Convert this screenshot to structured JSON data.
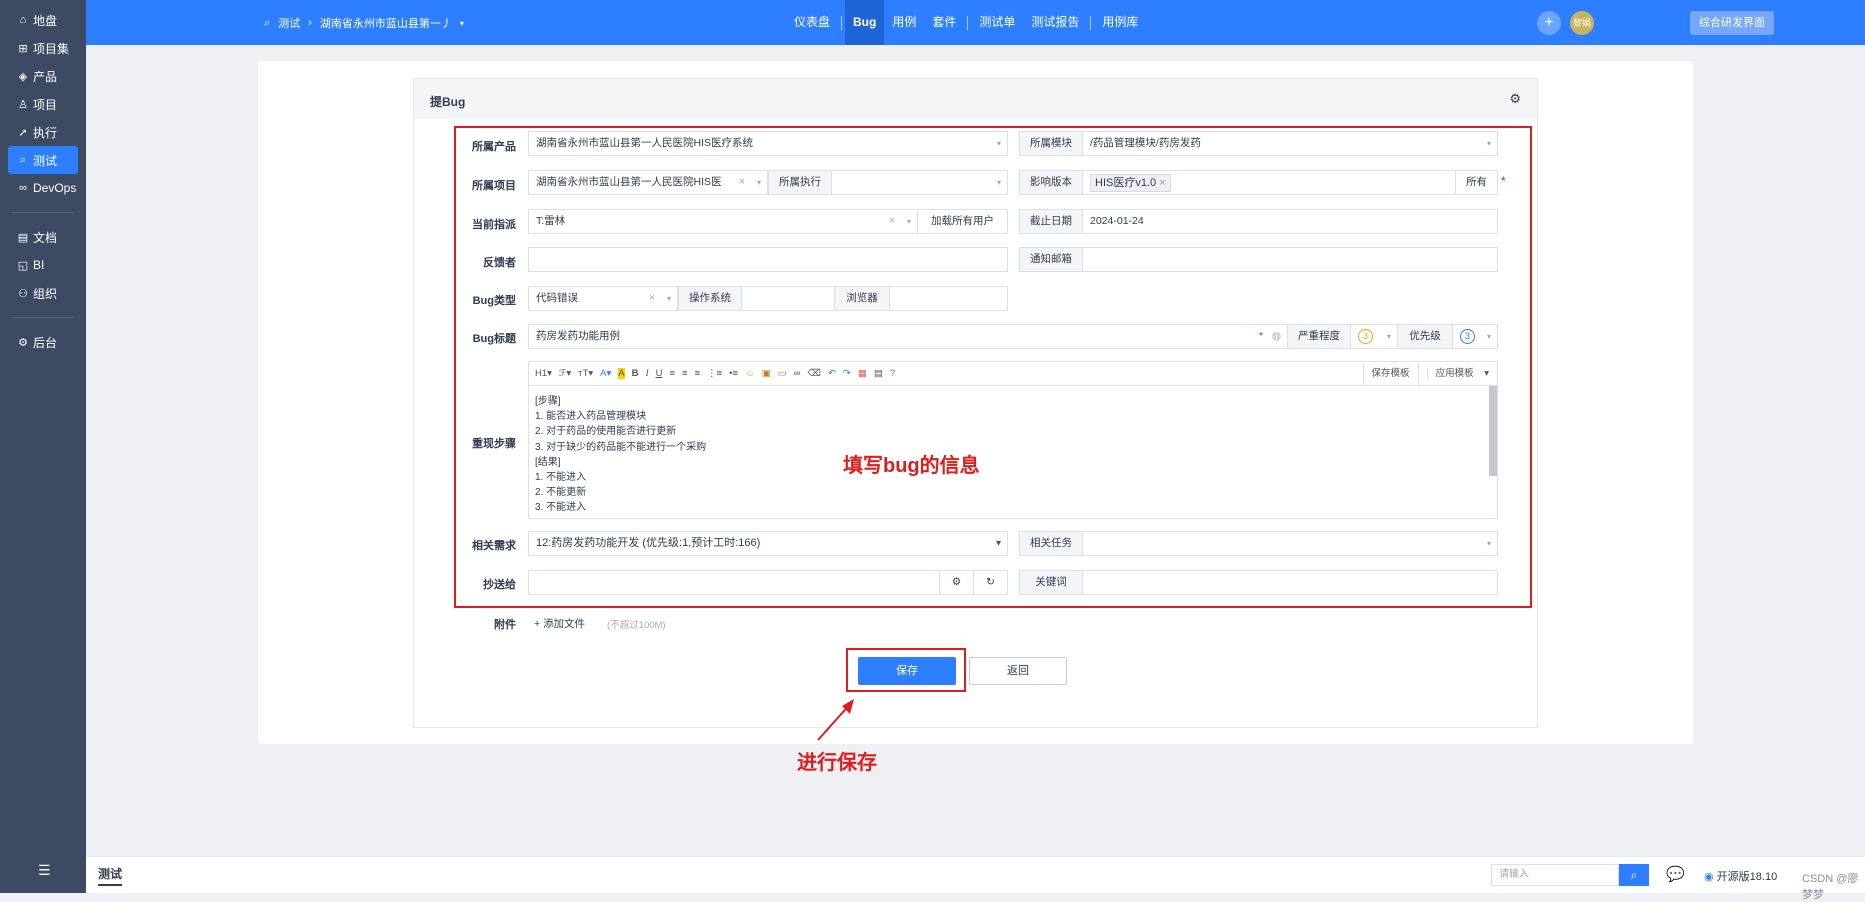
{
  "sidebar": {
    "items": [
      {
        "icon": "⌂",
        "label": "地盘"
      },
      {
        "icon": "⊞",
        "label": "项目集"
      },
      {
        "icon": "◈",
        "label": "产品"
      },
      {
        "icon": "♙",
        "label": "项目"
      },
      {
        "icon": "➚",
        "label": "执行"
      },
      {
        "icon": "⌕",
        "label": "测试"
      },
      {
        "icon": "∞",
        "label": "DevOps"
      },
      {
        "icon": "▤",
        "label": "文档"
      },
      {
        "icon": "◱",
        "label": "BI"
      },
      {
        "icon": "⚇",
        "label": "组织"
      },
      {
        "icon": "⚙",
        "label": "后台"
      }
    ]
  },
  "header": {
    "crumb_module": "测试",
    "crumb_product": "湖南省永州市蓝山县第一丿",
    "nav": [
      "仪表盘",
      "Bug",
      "用例",
      "套件",
      "测试单",
      "测试报告",
      "用例库"
    ],
    "avatar_text": "黎娟",
    "switch_label": "综合研发界面"
  },
  "form": {
    "title": "提Bug",
    "product_label": "所属产品",
    "product_value": "湖南省永州市蓝山县第一人民医院HIS医疗系统",
    "module_label": "所属模块",
    "module_value": "/药品管理模块/药房发药",
    "project_label": "所属项目",
    "project_value": "湖南省永州市蓝山县第一人民医院HIS医",
    "execution_label": "所属执行",
    "execution_value": "",
    "build_label": "影响版本",
    "build_tag": "HIS医疗v1.0",
    "build_all": "所有",
    "assign_label": "当前指派",
    "assign_value": "T:雷林",
    "load_users": "加载所有用户",
    "deadline_label": "截止日期",
    "deadline_value": "2024-01-24",
    "feedback_label": "反馈者",
    "feedback_value": "",
    "notify_label": "通知邮箱",
    "notify_value": "",
    "type_label": "Bug类型",
    "type_value": "代码错误",
    "os_label": "操作系统",
    "os_value": "",
    "browser_label": "浏览器",
    "browser_value": "",
    "title_label": "Bug标题",
    "title_value": "药房发药功能用例",
    "severity_label": "严重程度",
    "severity_value": "3",
    "priority_label": "优先级",
    "priority_value": "3",
    "steps_label": "重现步骤",
    "steps_lines": [
      "[步骤]",
      "1. 能否进入药品管理模块",
      "2. 对于药品的使用能否进行更新",
      "3. 对于缺少的药品能不能进行一个采购",
      "[结果]",
      "1. 不能进入",
      "2. 不能更新",
      "3. 不能进入"
    ],
    "save_template": "保存模板",
    "apply_template": "应用模板",
    "story_label": "相关需求",
    "story_value": "12:药房发药功能开发 (优先级:1,预计工时:166)",
    "task_label": "相关任务",
    "task_value": "",
    "mailto_label": "抄送给",
    "mailto_value": "",
    "keywords_label": "关键词",
    "keywords_value": "",
    "files_label": "附件",
    "add_file": "添加文件",
    "file_limit": "(不超过100M)",
    "save_button": "保存",
    "back_button": "返回"
  },
  "annotations": {
    "fill_info": "填写bug的信息",
    "save_note": "进行保存"
  },
  "bottom": {
    "tab": "测试",
    "search_placeholder": "请输入",
    "version": "开源版18.10",
    "watermark": "CSDN @廖梦梦"
  },
  "colors": {
    "primary": "#2e7fff",
    "sidebar": "#3c4a64",
    "annotation": "#e01c1c"
  }
}
